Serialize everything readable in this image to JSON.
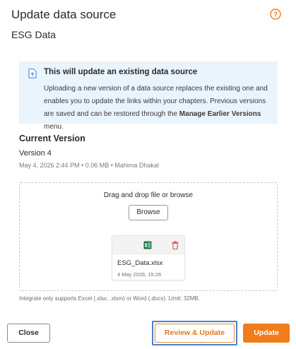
{
  "dialog": {
    "title": "Update data source",
    "subtitle": "ESG Data"
  },
  "info": {
    "title": "This will update an existing data source",
    "text_part1": "Uploading a new version of a data source replaces the existing one and enables you to update the links within your chapters. Previous versions are saved and can be restored through the ",
    "link_text": "Manage Earlier Versions",
    "text_part2": " menu."
  },
  "current_version": {
    "heading": "Current Version",
    "version_label": "Version 4",
    "meta": "May 4, 2026 2:44 PM • 0.06 MB • Mahima Dhakal"
  },
  "dropzone": {
    "prompt": "Drag and drop file or browse",
    "browse_label": "Browse",
    "file": {
      "name": "ESG_Data.xlsx",
      "date": "4 May 2026, 15:26"
    }
  },
  "note": "Integrate only supports Excel (.xlsx, .xlsm) or Word (.docx). Limit: 32MB.",
  "buttons": {
    "close": "Close",
    "review_update": "Review & Update",
    "update": "Update"
  },
  "colors": {
    "accent": "#f07c1c",
    "info_bg": "#eaf4fc",
    "focus_ring": "#4a7fd4",
    "excel_green": "#1e7145",
    "delete_red": "#d9534f"
  }
}
